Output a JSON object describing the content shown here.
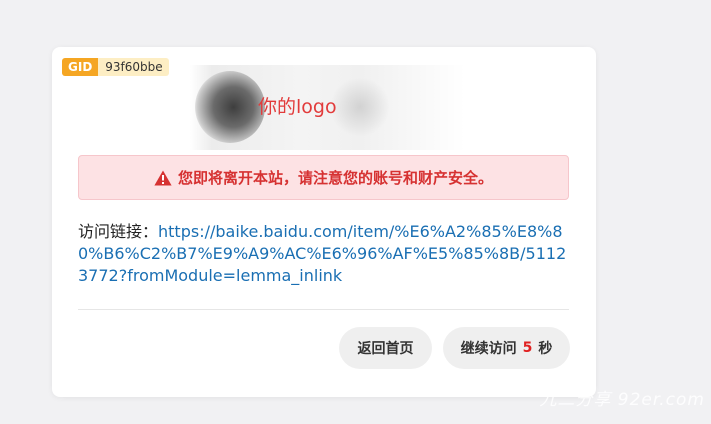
{
  "gid": {
    "label": "GID",
    "value": "93f60bbe"
  },
  "logo": {
    "text": "你的logo"
  },
  "alert": {
    "icon": "warning-triangle-icon",
    "message": "您即将离开本站，请注意您的账号和财产安全。",
    "color": "#d63232"
  },
  "link": {
    "label": "访问链接：",
    "url": "https://baike.baidu.com/item/%E6%A2%85%E8%80%B6%C2%B7%E9%A9%AC%E6%96%AF%E5%85%8B/51123772?fromModule=lemma_inlink"
  },
  "buttons": {
    "home_label": "返回首页",
    "continue_prefix": "继续访问",
    "countdown": "5",
    "continue_suffix": "秒"
  },
  "watermark": "九二分享 92er.com"
}
